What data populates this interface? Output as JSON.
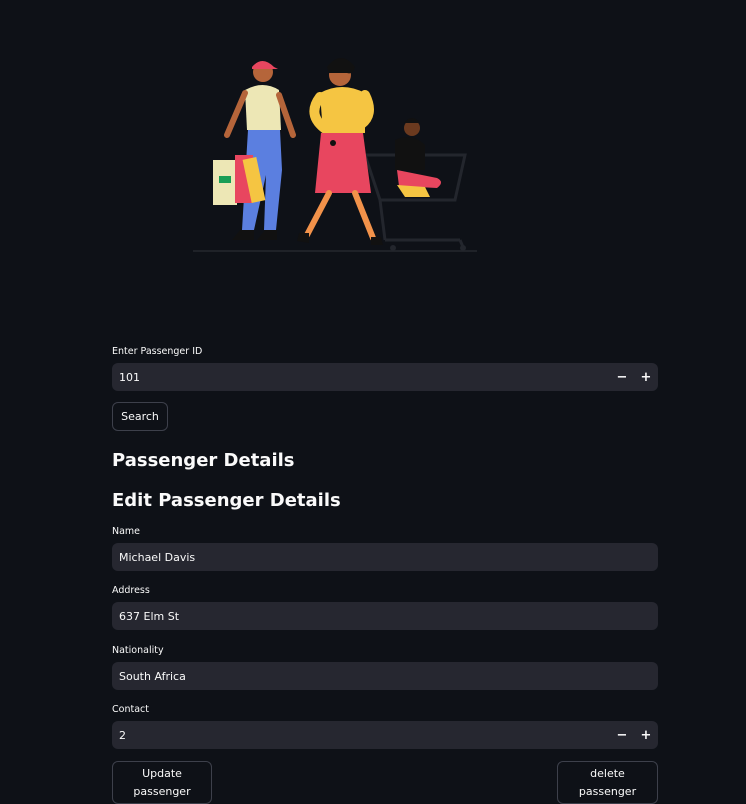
{
  "search": {
    "label": "Enter Passenger ID",
    "value": "101",
    "minus": "−",
    "plus": "+",
    "button": "Search"
  },
  "headings": {
    "details": "Passenger Details",
    "edit": "Edit Passenger Details"
  },
  "form": {
    "name_label": "Name",
    "name_value": "Michael Davis",
    "address_label": "Address",
    "address_value": "637 Elm St",
    "nationality_label": "Nationality",
    "nationality_value": "South Africa",
    "contact_label": "Contact",
    "contact_value": "2",
    "minus": "−",
    "plus": "+"
  },
  "actions": {
    "update_line1": "Update",
    "update_line2": "passenger",
    "delete_line1": "delete",
    "delete_line2": "passenger"
  },
  "illustration": {
    "icon": "shopping-family-illustration",
    "colors": {
      "yellow": "#f5c542",
      "pink": "#e8465f",
      "blue": "#5b7fe0",
      "skin": "#b5653a"
    }
  }
}
